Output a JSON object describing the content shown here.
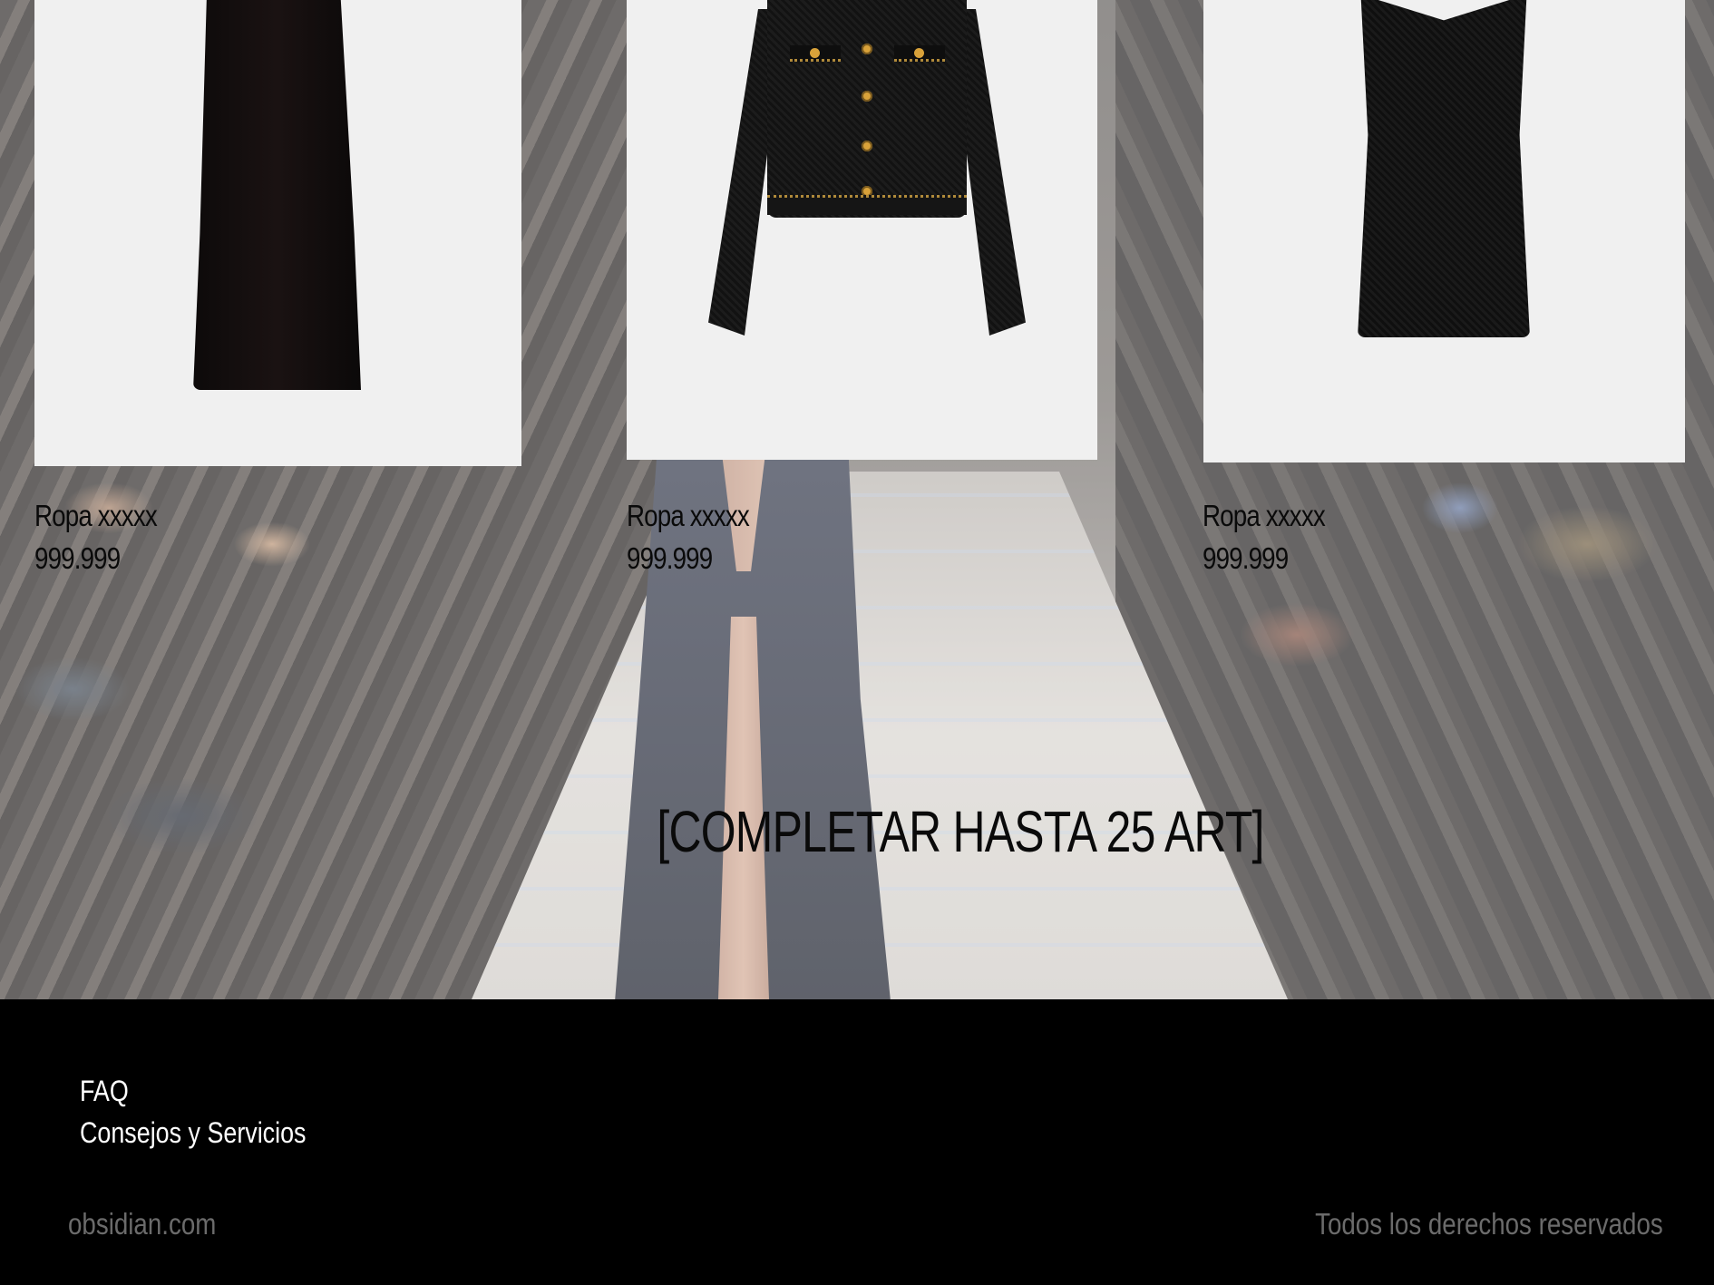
{
  "products": [
    {
      "name": "Ropa xxxxx",
      "price": "999.999"
    },
    {
      "name": "Ropa xxxxx",
      "price": "999.999"
    },
    {
      "name": "Ropa xxxxx",
      "price": "999.999"
    }
  ],
  "placeholder_text": "[COMPLETAR HASTA 25 ART]",
  "footer": {
    "links": [
      "FAQ",
      "Consejos y Servicios"
    ],
    "brand": "obsidian.com",
    "rights": "Todos los derechos reservados"
  },
  "colors": {
    "footer_bg": "#000000",
    "footer_link": "#ffffff",
    "footer_muted": "#6b6b6b",
    "card_bg": "#f0f0f0",
    "text_dark": "#0a0a0a"
  }
}
